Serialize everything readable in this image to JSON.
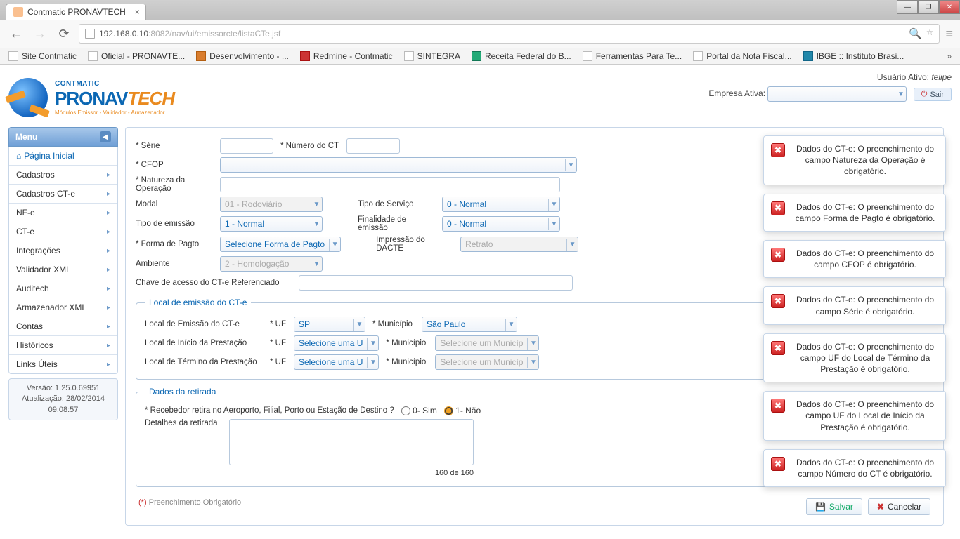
{
  "browser": {
    "tab_title": "Contmatic PRONAVTECH",
    "url_host": "192.168.0.10",
    "url_port": ":8082",
    "url_path": "/nav/ui/emissorcte/listaCTe.jsf",
    "bookmarks": [
      "Site Contmatic",
      "Oficial - PRONAVTE...",
      "Desenvolvimento - ...",
      "Redmine - Contmatic",
      "SINTEGRA",
      "Receita Federal do B...",
      "Ferramentas Para Te...",
      "Portal da Nota Fiscal...",
      "IBGE :: Instituto Brasi..."
    ]
  },
  "brand": {
    "small": "CONTMATIC",
    "big1": "PRONAV",
    "big2": "TECH",
    "tag": "Módulos Emissor - Validador - Armazenador"
  },
  "user": {
    "active_label": "Usuário Ativo:",
    "active_value": "felipe",
    "company_label": "Empresa Ativa:",
    "company_value": "",
    "sair": "Sair"
  },
  "sidebar": {
    "header": "Menu",
    "home": "Página Inicial",
    "items": [
      "Cadastros",
      "Cadastros CT-e",
      "NF-e",
      "CT-e",
      "Integrações",
      "Validador XML",
      "Auditech",
      "Armazenador XML",
      "Contas",
      "Históricos",
      "Links Úteis"
    ],
    "version": "Versão: 1.25.0.69951",
    "update": "Atualização: 28/02/2014",
    "time": "09:08:57"
  },
  "form": {
    "serie": "Série",
    "numero_ct": "Número do CT",
    "cfop": "CFOP",
    "natureza": "Natureza da Operação",
    "modal": {
      "label": "Modal",
      "value": "01 - Rodoviário"
    },
    "tipo_emissao": {
      "label": "Tipo de emissão",
      "value": "1 - Normal"
    },
    "forma_pagto": {
      "label": "Forma de Pagto",
      "value": "Selecione Forma de Pagto"
    },
    "ambiente": {
      "label": "Ambiente",
      "value": "2 - Homologação"
    },
    "tipo_servico": {
      "label": "Tipo de Serviço",
      "value": "0 - Normal"
    },
    "finalidade": {
      "label": "Finalidade de emissão",
      "value": "0 - Normal"
    },
    "impressao": {
      "label": "Impressão do DACTE",
      "value": "Retrato"
    },
    "chave_ref": "Chave de acesso do CT-e Referenciado",
    "local_legend": "Local de emissão do CT-e",
    "local_emissao": "Local de Emissão do CT-e",
    "local_inicio": "Local de Início da Prestação",
    "local_termino": "Local de Término da Prestação",
    "uf_label": "UF",
    "uf_sp": "SP",
    "uf_sel": "Selecione uma U",
    "municipio_label": "Município",
    "municipio_sp": "São Paulo",
    "municipio_sel": "Selecione um Municíp",
    "retirada_legend": "Dados da retirada",
    "recebedor_q": "Recebedor retira no Aeroporto, Filial, Porto ou Estação de Destino ?",
    "op_sim": "0- Sim",
    "op_nao": "1- Não",
    "detalhes": "Detalhes da retirada",
    "char_count": "160 de 160",
    "oblig": "(*) Preenchimento Obrigatório",
    "salvar": "Salvar",
    "cancelar": "Cancelar"
  },
  "toasts": [
    "Dados do CT-e: O preenchimento do campo Natureza da Operação é obrigatório.",
    "Dados do CT-e: O preenchimento do campo Forma de Pagto é obrigatório.",
    "Dados do CT-e: O preenchimento do campo CFOP é obrigatório.",
    "Dados do CT-e: O preenchimento do campo Série é obrigatório.",
    "Dados do CT-e: O preenchimento do campo UF do Local de Término da Prestação é obrigatório.",
    "Dados do CT-e: O preenchimento do campo UF do Local de Início da Prestação é obrigatório.",
    "Dados do CT-e: O preenchimento do campo Número do CT é obrigatório."
  ]
}
